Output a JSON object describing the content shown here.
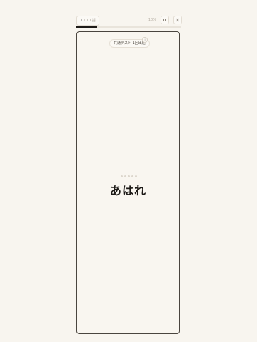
{
  "header": {
    "current": "1",
    "total": "/ 10 語",
    "percent": "10%",
    "progress": 0.2
  },
  "card": {
    "source": "共通テスト 1回出題",
    "info_icon": "info-icon",
    "rating_dots": 5,
    "word": "あはれ"
  },
  "icons": {
    "list": "list-icon",
    "close": "close-icon"
  }
}
